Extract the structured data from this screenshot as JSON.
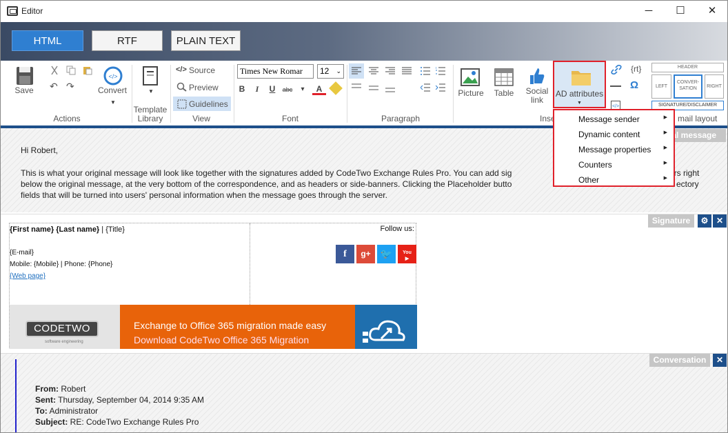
{
  "window": {
    "title": "Editor",
    "minimize": "─",
    "maximize": "☐",
    "close": "✕"
  },
  "modes": {
    "html": "HTML",
    "rtf": "RTF",
    "plain": "PLAIN TEXT"
  },
  "ribbon": {
    "actions": {
      "save": "Save",
      "convert": "Convert",
      "label": "Actions"
    },
    "template": {
      "label1": "Template",
      "label2": "Library"
    },
    "view": {
      "source": "Source",
      "preview": "Preview",
      "guidelines": "Guidelines",
      "label": "View"
    },
    "font": {
      "family": "Times New Romar",
      "size": "12",
      "label": "Font"
    },
    "paragraph": {
      "label": "Paragraph"
    },
    "insert": {
      "picture": "Picture",
      "table": "Table",
      "social1": "Social",
      "social2": "link",
      "ad": "AD attributes",
      "label": "Inse",
      "rt": "{rt}"
    },
    "layout": {
      "header": "HEADER",
      "left": "LEFT",
      "conv1": "CONVER-",
      "conv2": "SATION",
      "right": "RIGHT",
      "sig": "SIGNATURE/DISCLAIMER",
      "label": "mail layout"
    }
  },
  "ad_menu": {
    "items": [
      "Message sender",
      "Dynamic content",
      "Message properties",
      "Counters",
      "Other"
    ]
  },
  "original": {
    "tag": "nal message",
    "greeting": "Hi Robert,",
    "line1": "This is what your original message will look like together with the signatures added by CodeTwo Exchange Rules Pro. You can add sig",
    "line1b": "ers right",
    "line2": "below the original message, at the very bottom of the correspondence, and as headers or side-banners. Clicking the Placeholder butto",
    "line2b": "ectory",
    "line3": "fields that will be turned into users' personal information when the message goes through the server."
  },
  "signature": {
    "tag": "Signature",
    "name": "{First name} {Last name}",
    "sep": " | ",
    "title": "{Title}",
    "email": "{E-mail}",
    "phones": "Mobile: {Mobile} | Phone: {Phone}",
    "web": "{Web page}",
    "follow": "Follow us:",
    "logo": "CODETWO",
    "logo_sub": "software engineering",
    "banner1": "Exchange to Office 365 migration made easy",
    "banner2": "Download CodeTwo Office 365 Migration"
  },
  "conversation": {
    "tag": "Conversation",
    "from_label": "From:",
    "from": " Robert",
    "sent_label": "Sent:",
    "sent": " Thursday, September 04, 2014 9:35 AM",
    "to_label": "To:",
    "to": " Administrator",
    "subject_label": "Subject:",
    "subject": " RE: CodeTwo Exchange Rules Pro"
  },
  "colors": {
    "accent": "#2f7fd1",
    "navy": "#1d4f8a",
    "highlight_red": "#e0202a",
    "banner_orange": "#e8630a"
  }
}
